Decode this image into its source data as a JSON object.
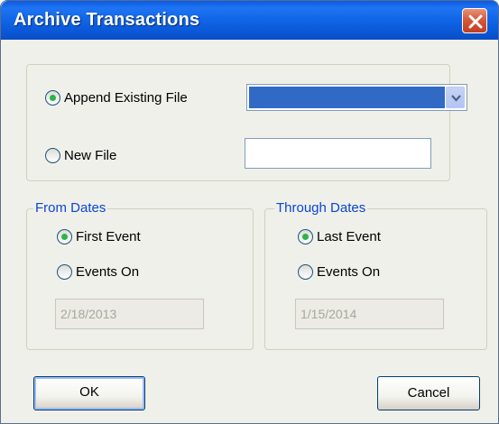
{
  "window": {
    "title": "Archive Transactions"
  },
  "archive_target": {
    "append_label": "Append Existing File",
    "append_selected": true,
    "existing_file_value": "",
    "new_file_label": "New File",
    "new_file_selected": false,
    "new_file_value": ""
  },
  "from_dates": {
    "legend": "From Dates",
    "first_event_label": "First Event",
    "first_event_selected": true,
    "events_on_label": "Events On",
    "events_on_selected": false,
    "date_value": "2/18/2013"
  },
  "through_dates": {
    "legend": "Through Dates",
    "last_event_label": "Last Event",
    "last_event_selected": true,
    "events_on_label": "Events On",
    "events_on_selected": false,
    "date_value": "1/15/2014"
  },
  "buttons": {
    "ok_label": "OK",
    "cancel_label": "Cancel"
  },
  "icons": {
    "close": "close-icon",
    "dropdown": "chevron-down-icon"
  },
  "colors": {
    "titlebar": "#0a5ae0",
    "group_legend": "#0a46d5",
    "selection": "#316ac5",
    "close_button": "#d6593a"
  }
}
